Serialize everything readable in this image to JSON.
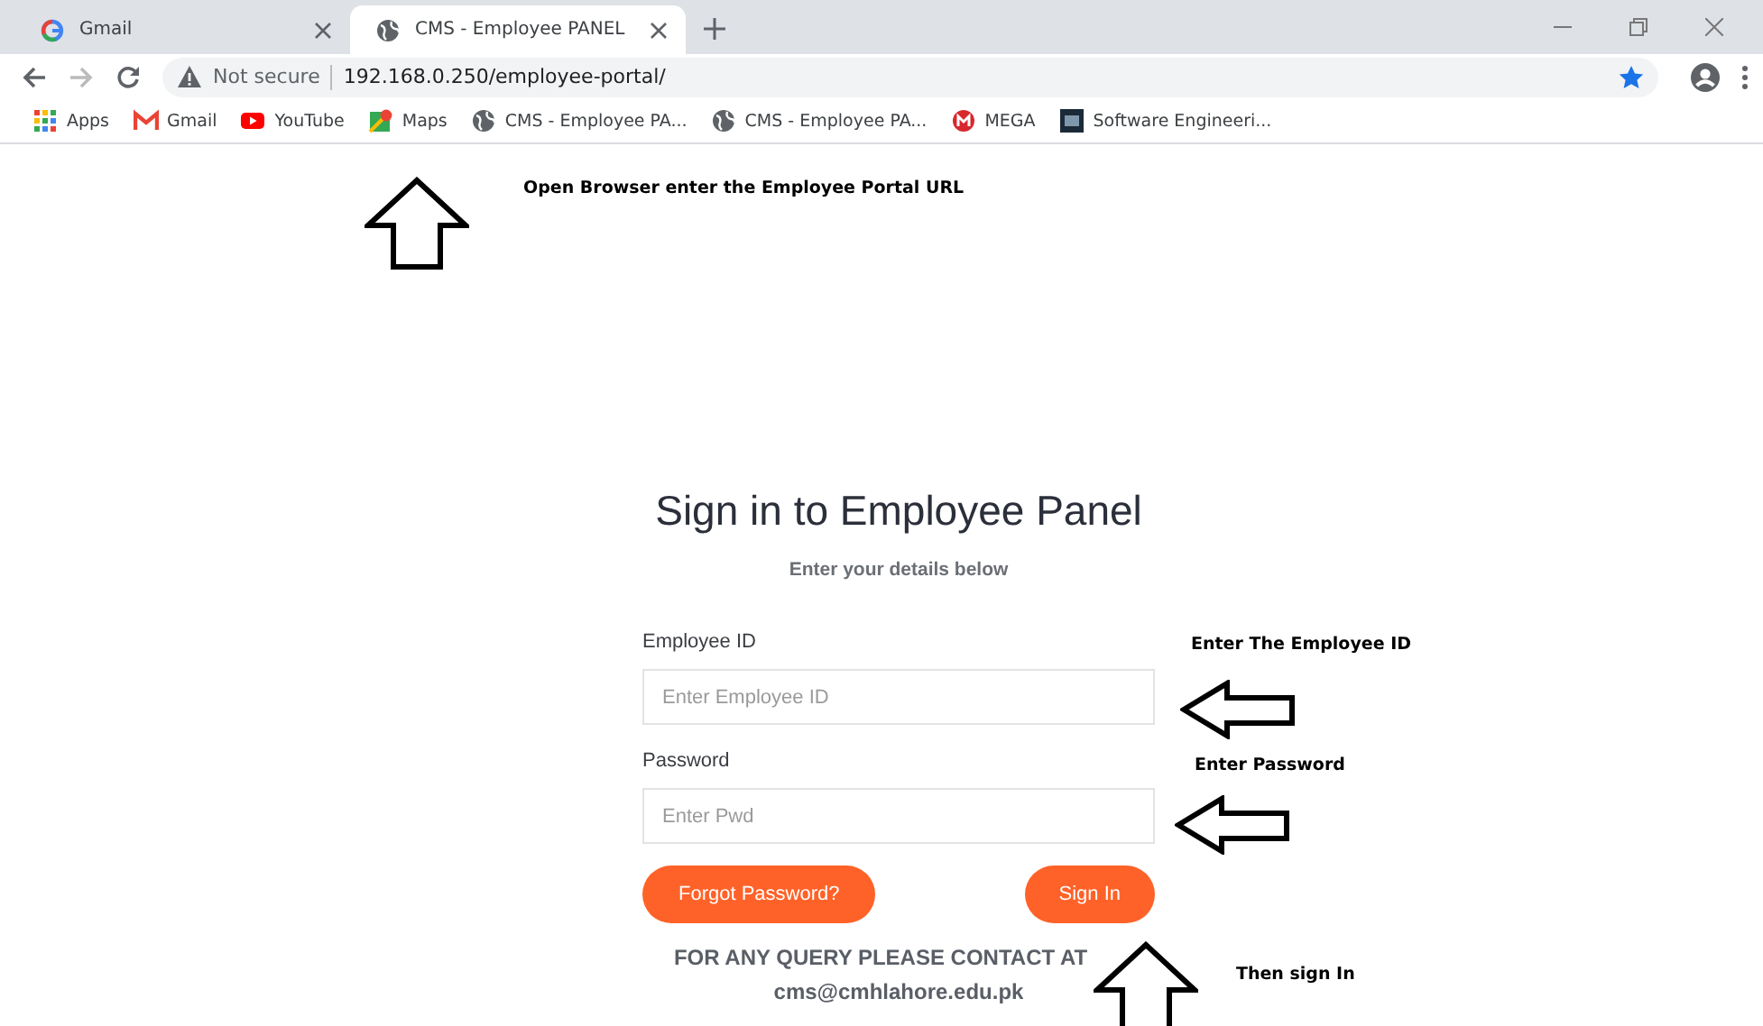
{
  "browser": {
    "tabs": [
      {
        "title": "Gmail",
        "selected": false
      },
      {
        "title": "CMS - Employee PANEL",
        "selected": true
      }
    ],
    "address": {
      "security": "Not secure",
      "url": "192.168.0.250/employee-portal/"
    },
    "bookmarks": [
      {
        "label": "Apps"
      },
      {
        "label": "Gmail"
      },
      {
        "label": "YouTube"
      },
      {
        "label": "Maps"
      },
      {
        "label": "CMS - Employee PA..."
      },
      {
        "label": "CMS - Employee PA..."
      },
      {
        "label": "MEGA"
      },
      {
        "label": "Software Engineeri..."
      }
    ]
  },
  "page": {
    "title": "Sign in to Employee Panel",
    "subtitle": "Enter your details below",
    "fields": [
      {
        "label": "Employee ID",
        "placeholder": "Enter Employee ID"
      },
      {
        "label": "Password",
        "placeholder": "Enter Pwd"
      }
    ],
    "buttons": [
      "Forgot Password?",
      "Sign In"
    ],
    "contact": [
      "FOR ANY QUERY PLEASE CONTACT AT",
      "cms@cmhlahore.edu.pk"
    ]
  },
  "annotations": [
    {
      "kind": "up-arrow"
    },
    {
      "kind": "note",
      "text": "Open Browser enter the Employee Portal URL"
    },
    {
      "kind": "note",
      "text": "Enter The Employee ID"
    },
    {
      "kind": "left-arrow"
    },
    {
      "kind": "note",
      "text": "Enter Password"
    },
    {
      "kind": "left-arrow"
    },
    {
      "kind": "up-arrow"
    },
    {
      "kind": "note",
      "text": "Then sign In"
    }
  ]
}
